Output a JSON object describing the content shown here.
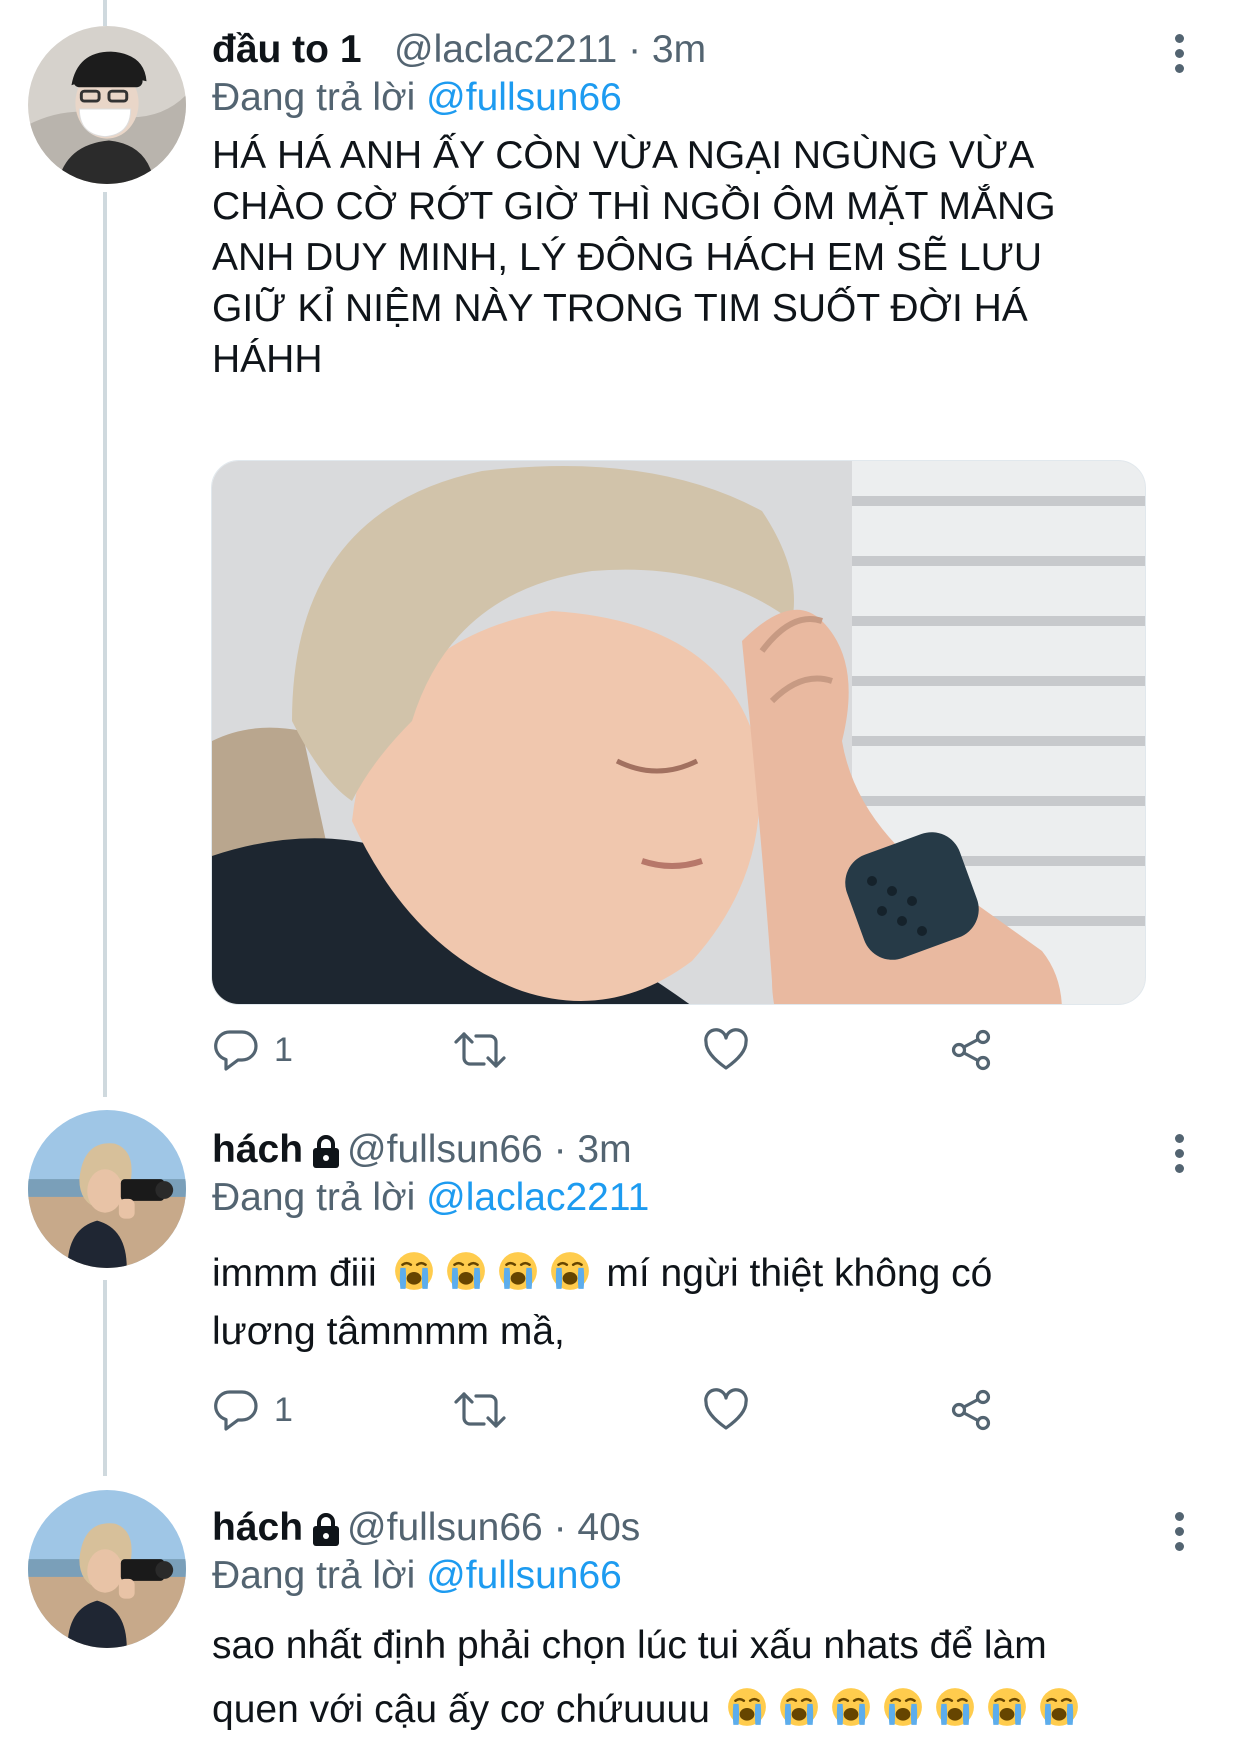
{
  "tweets": [
    {
      "name": "đầu to 1",
      "handle": "@laclac2211",
      "time": "3m",
      "replying_prefix": "Đang trả lời",
      "replying_to": "@fullsun66",
      "text_lines": [
        "HÁ HÁ ANH ẤY CÒN VỪA NGẠI NGÙNG VỪA",
        "CHÀO CỜ RỚT GIỜ THÌ NGỒI ÔM MẶT MẮNG",
        "ANH DUY MINH, LÝ ĐÔNG HÁCH EM SẼ LƯU",
        "GIỮ KỈ NIỆM NÀY TRONG TIM SUỐT ĐỜI HÁ",
        "HÁHH"
      ],
      "reply_count": "1",
      "avatar_icon": "masked-person-black-cap-avatar",
      "media_icon": "person-covering-face-photo"
    },
    {
      "name": "hách",
      "handle": "@fullsun66",
      "time": "3m",
      "protected": true,
      "replying_prefix": "Đang trả lời",
      "replying_to": "@laclac2211",
      "text_line1_a": "immm điii",
      "text_line1_b": "mí ngừi thiệt không có",
      "text_line2": "lương tâmmmm mầ,",
      "emoji_count_line1": 4,
      "reply_count": "1",
      "avatar_icon": "person-with-camera-beach-avatar"
    },
    {
      "name": "hách",
      "handle": "@fullsun66",
      "time": "40s",
      "protected": true,
      "replying_prefix": "Đang trả lời",
      "replying_to": "@fullsun66",
      "text_line1": "sao nhất định phải chọn lúc tui xấu nhats để làm",
      "text_line2": "quen với cậu ấy cơ chứuuuu",
      "emoji_count_line2": 7,
      "avatar_icon": "person-with-camera-beach-avatar"
    }
  ],
  "icons": {
    "reply": "reply-bubble-icon",
    "retweet": "retweet-icon",
    "like": "heart-icon",
    "share": "share-icon",
    "more": "more-vertical-icon",
    "lock": "lock-icon",
    "emoji": "loudly-crying-face-emoji"
  },
  "colors": {
    "link": "#1d9bf0",
    "secondary_text": "#536471",
    "thread_line": "#cfd9de"
  }
}
